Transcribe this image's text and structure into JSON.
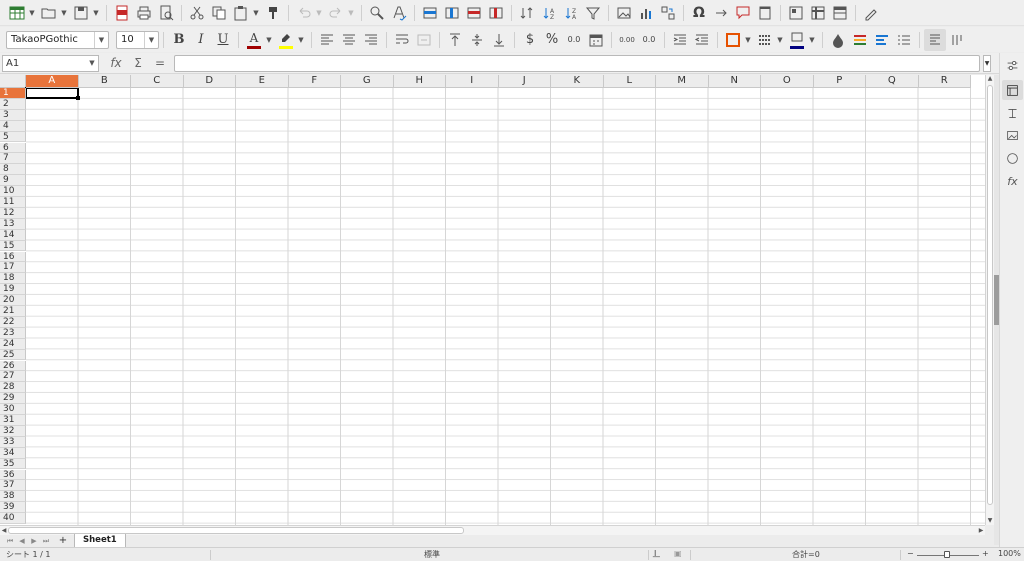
{
  "toolbar2": {
    "font_name": "TakaoPGothic",
    "font_size": "10",
    "font_color": "#a00000",
    "highlight_color": "#ffff00",
    "border_color": "#000080",
    "bold_label": "B",
    "italic_label": "I",
    "underline_label": "U",
    "currency_label": "$",
    "percent_label": "%",
    "number_label": "0.0",
    "add_decimal_label": "0.00",
    "del_decimal_label": "0.0"
  },
  "formula_bar": {
    "name_box": "A1",
    "fx_label": "fx",
    "sum_label": "Σ",
    "equals_label": "=",
    "value": ""
  },
  "grid": {
    "columns": [
      "A",
      "B",
      "C",
      "D",
      "E",
      "F",
      "G",
      "H",
      "I",
      "J",
      "K",
      "L",
      "M",
      "N",
      "O",
      "P",
      "Q",
      "R"
    ],
    "rows": [
      "1",
      "2",
      "3",
      "4",
      "5",
      "6",
      "7",
      "8",
      "9",
      "10",
      "11",
      "12",
      "13",
      "14",
      "15",
      "16",
      "17",
      "18",
      "19",
      "20",
      "21",
      "22",
      "23",
      "24",
      "25",
      "26",
      "27",
      "28",
      "29",
      "30",
      "31",
      "32",
      "33",
      "34",
      "35",
      "36",
      "37",
      "38",
      "39",
      "40"
    ],
    "selected_cell": "A1",
    "selection_color": "#e8743b"
  },
  "sheets": {
    "add_label": "+",
    "tabs": [
      "Sheet1"
    ]
  },
  "status": {
    "sheet_position": "シート 1 / 1",
    "page_style": "標準",
    "sum": "合計=0",
    "zoom_minus": "−",
    "zoom_plus": "+",
    "zoom": "100%"
  }
}
